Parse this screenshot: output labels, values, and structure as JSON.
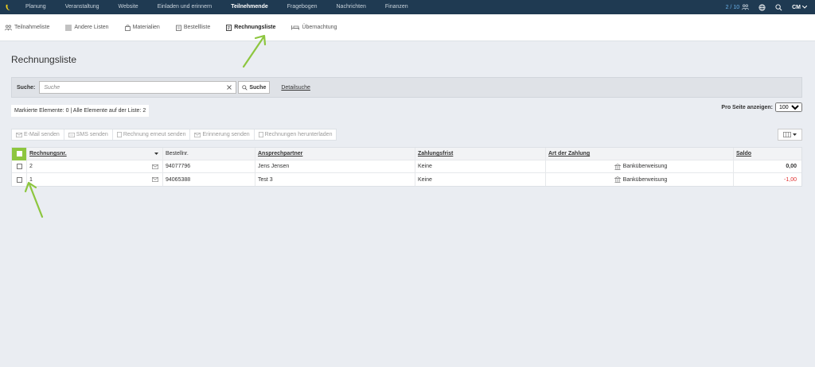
{
  "topnav": {
    "items": [
      "Planung",
      "Veranstaltung",
      "Website",
      "Einladen und erinnern",
      "Teilnehmende",
      "Fragebogen",
      "Nachrichten",
      "Finanzen"
    ],
    "active_index": 4,
    "counter": "2 / 10",
    "user_initials": "CM"
  },
  "subnav": {
    "items": [
      "Teilnahmeliste",
      "Andere Listen",
      "Materialien",
      "Bestellliste",
      "Rechnungsliste",
      "Übernachtung"
    ],
    "active_index": 4
  },
  "page": {
    "title": "Rechnungsliste"
  },
  "search": {
    "label": "Suche:",
    "placeholder": "Suche",
    "button": "Suche",
    "detail_link": "Detailsuche"
  },
  "status": {
    "marked": "Markierte Elemente: 0 | Alle Elemente auf der Liste: 2",
    "per_page_label": "Pro Seite anzeigen:",
    "per_page_value": "100"
  },
  "actions": [
    "E-Mail senden",
    "SMS senden",
    "Rechnung erneut senden",
    "Erinnerung senden",
    "Rechnungen herunterladen"
  ],
  "table": {
    "headers": {
      "nr": "Rechnungsnr.",
      "bestell": "Bestellnr.",
      "ansprech": "Ansprechpartner",
      "frist": "Zahlungsfrist",
      "art": "Art der Zahlung",
      "saldo": "Saldo"
    },
    "rows": [
      {
        "nr": "2",
        "bestell": "94077796",
        "ansprech": "Jens Jensen",
        "frist": "Keine",
        "art": "Banküberweisung",
        "saldo": "0,00"
      },
      {
        "nr": "1",
        "bestell": "94065388",
        "ansprech": "Test 3",
        "frist": "Keine",
        "art": "Banküberweisung",
        "saldo": "-1,00"
      }
    ]
  },
  "colors": {
    "nav_bg": "#1f3a52",
    "accent_green": "#8dc63f",
    "negative": "#e03030",
    "counter": "#6ab0e8"
  }
}
